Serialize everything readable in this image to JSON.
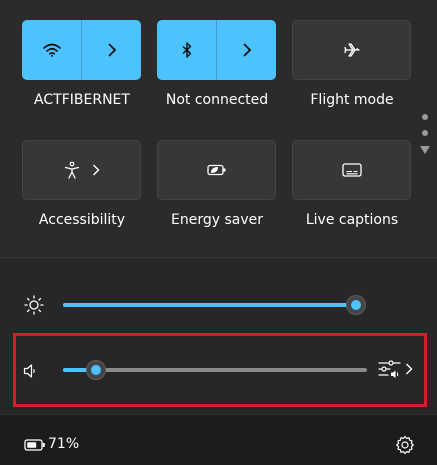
{
  "tiles": [
    {
      "id": "wifi",
      "label": "ACTFIBERNET",
      "state": "on",
      "icon": "wifi-icon",
      "has_chevron": true
    },
    {
      "id": "bluetooth",
      "label": "Not connected",
      "state": "on",
      "icon": "bluetooth-icon",
      "has_chevron": true
    },
    {
      "id": "flight",
      "label": "Flight mode",
      "state": "off",
      "icon": "airplane-icon",
      "has_chevron": false
    },
    {
      "id": "accessibility",
      "label": "Accessibility",
      "state": "off",
      "icon": "accessibility-icon",
      "has_chevron": true
    },
    {
      "id": "energy",
      "label": "Energy saver",
      "state": "off",
      "icon": "energy-saver-icon",
      "has_chevron": false
    },
    {
      "id": "captions",
      "label": "Live captions",
      "state": "off",
      "icon": "captions-icon",
      "has_chevron": false
    }
  ],
  "sliders": {
    "brightness": {
      "icon": "brightness-icon",
      "level_fraction": 1.0
    },
    "volume": {
      "icon": "speaker-icon",
      "level_fraction": 0.11
    }
  },
  "footer": {
    "battery_percent": "71%",
    "battery_icon": "battery-icon",
    "settings_icon": "gear-icon"
  },
  "colors": {
    "accent": "#4cc2ff",
    "highlight": "#d21f2a"
  }
}
